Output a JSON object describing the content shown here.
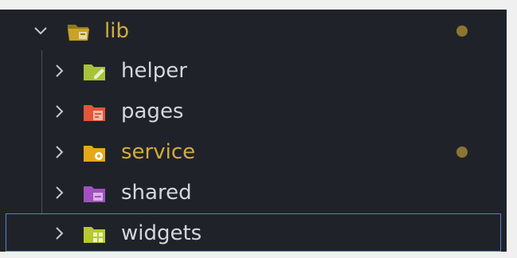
{
  "tree": {
    "root": {
      "label": "lib",
      "expanded": true,
      "modified": true,
      "icon": "folder-lib-open-icon",
      "color": "#c9a227"
    },
    "children": [
      {
        "label": "helper",
        "modified": false,
        "icon": "folder-helper-icon",
        "color": "#a8c23a"
      },
      {
        "label": "pages",
        "modified": false,
        "icon": "folder-pages-icon",
        "color": "#e2563a"
      },
      {
        "label": "service",
        "modified": true,
        "icon": "folder-service-icon",
        "color": "#e6a817"
      },
      {
        "label": "shared",
        "modified": false,
        "icon": "folder-shared-icon",
        "color": "#a24fc2"
      },
      {
        "label": "widgets",
        "modified": false,
        "selected": true,
        "icon": "folder-widgets-icon",
        "color": "#b6c930"
      }
    ]
  },
  "colors": {
    "background": "#1f2329",
    "text": "#d4d7dc",
    "modified_text": "#d4ac3d",
    "modified_dot": "#8b7530",
    "selection_border": "#5c7cd1"
  }
}
